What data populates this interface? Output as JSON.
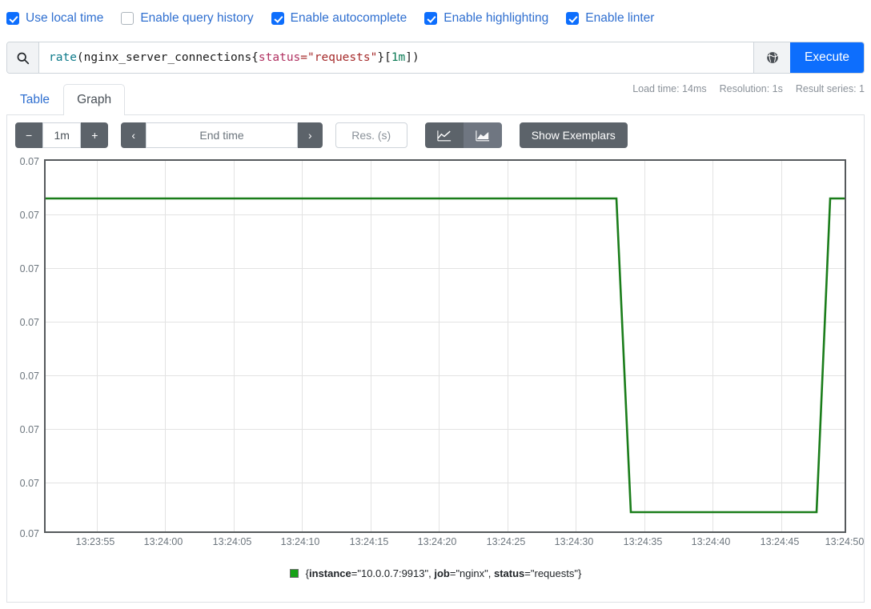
{
  "options": [
    {
      "label": "Use local time",
      "checked": true,
      "name": "use-local-time"
    },
    {
      "label": "Enable query history",
      "checked": false,
      "name": "enable-query-history"
    },
    {
      "label": "Enable autocomplete",
      "checked": true,
      "name": "enable-autocomplete"
    },
    {
      "label": "Enable highlighting",
      "checked": true,
      "name": "enable-highlighting"
    },
    {
      "label": "Enable linter",
      "checked": true,
      "name": "enable-linter"
    }
  ],
  "query": {
    "expression": "rate(nginx_server_connections{status=\"requests\"}[1m])",
    "tokens": {
      "fn": "rate",
      "open_paren": "(",
      "metric": "nginx_server_connections",
      "open_brace": "{",
      "label": "status",
      "equals": "=",
      "value": "\"requests\"",
      "close_brace": "}",
      "open_bracket": "[",
      "duration": "1m",
      "close_bracket": "]",
      "close_paren": ")"
    },
    "execute_label": "Execute",
    "search_icon": "search-icon",
    "globe_icon": "globe-icon"
  },
  "tabs": [
    {
      "label": "Table",
      "active": false
    },
    {
      "label": "Graph",
      "active": true
    }
  ],
  "stats": {
    "load_time": "Load time: 14ms",
    "resolution": "Resolution: 1s",
    "result_series": "Result series: 1"
  },
  "controls": {
    "decrease_label": "−",
    "range_value": "1m",
    "increase_label": "+",
    "prev_label": "‹",
    "end_time_placeholder": "End time",
    "next_label": "›",
    "resolution_placeholder": "Res. (s)",
    "line_chart_icon": "line-chart-icon",
    "stacked_chart_icon": "stacked-area-chart-icon",
    "show_exemplars_label": "Show Exemplars"
  },
  "chart_data": {
    "type": "line",
    "title": "",
    "xlabel": "",
    "ylabel": "",
    "grid": true,
    "legend_position": "bottom",
    "line_color": "#1a7d1a",
    "x_tick_labels": [
      "13:23:55",
      "13:24:00",
      "13:24:05",
      "13:24:10",
      "13:24:15",
      "13:24:20",
      "13:24:25",
      "13:24:30",
      "13:24:35",
      "13:24:40",
      "13:24:45",
      "13:24:50"
    ],
    "y_tick_labels": [
      "0.07",
      "0.07",
      "0.07",
      "0.07",
      "0.07",
      "0.07",
      "0.07",
      "0.07"
    ],
    "xlim": [
      "13:23:52",
      "13:24:52"
    ],
    "series": [
      {
        "name": "{instance=\"10.0.0.7:9913\", job=\"nginx\", status=\"requests\"}",
        "legend_labels": [
          {
            "key": "instance",
            "value": "\"10.0.0.7:9913\""
          },
          {
            "key": "job",
            "value": "\"nginx\""
          },
          {
            "key": "status",
            "value": "\"requests\""
          }
        ],
        "color": "#17a117",
        "points": [
          {
            "t": "13:23:52",
            "v": 0.07
          },
          {
            "t": "13:24:34",
            "v": 0.07
          },
          {
            "t": "13:24:36",
            "v": 0.0669
          },
          {
            "t": "13:24:49",
            "v": 0.0669
          },
          {
            "t": "13:24:51",
            "v": 0.07
          },
          {
            "t": "13:24:52",
            "v": 0.07
          }
        ]
      }
    ]
  }
}
